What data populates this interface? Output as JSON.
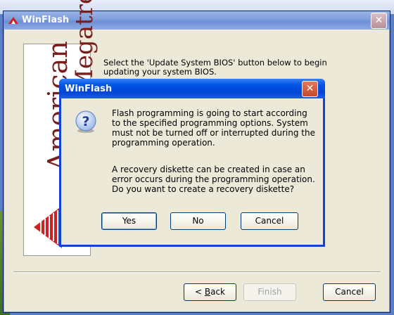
{
  "main_window": {
    "title": "WinFlash",
    "logo_text_line1": "American",
    "logo_text_line2": "Megatrends",
    "instruction": "Select the 'Update System BIOS' button below to begin updating your system BIOS.",
    "buttons": {
      "back_pre": "< ",
      "back_mnemonic": "B",
      "back_post": "ack",
      "finish": "Finish",
      "cancel": "Cancel"
    }
  },
  "dialog": {
    "title": "WinFlash",
    "icon": "question-icon",
    "message1": "Flash programming is going to start according to the specified programming options.  System must not be turned off or interrupted during the programming operation.",
    "message2": "A recovery diskette can be created in case an error occurs during the programming operation.  Do you want to create a recovery diskette?",
    "buttons": {
      "yes": "Yes",
      "no": "No",
      "cancel": "Cancel"
    }
  },
  "colors": {
    "dialog_title": "#0055e5",
    "main_title": "#7e9ddc",
    "logo": "#7a1d1d",
    "logo_mark": "#cc2222"
  }
}
